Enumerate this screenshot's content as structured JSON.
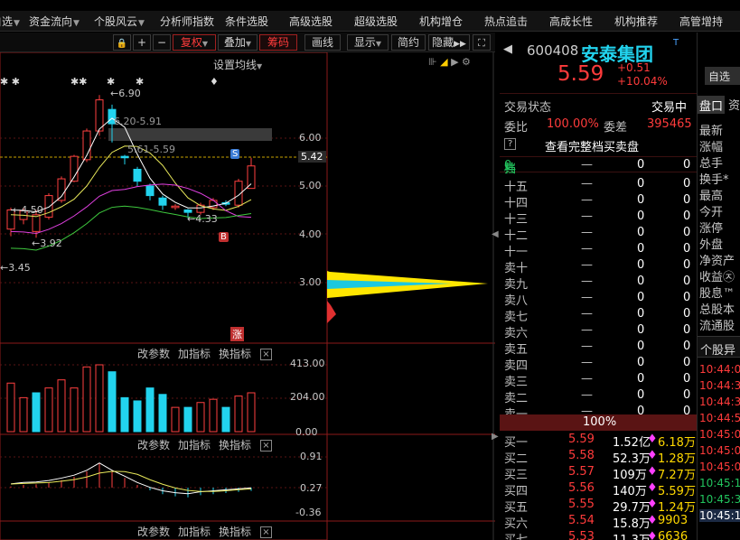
{
  "menu": {
    "items": [
      {
        "label": "自选",
        "dd": "▼"
      },
      {
        "label": "资金流向",
        "dd": "▼"
      },
      {
        "label": "个股风云",
        "dd": "▼"
      },
      {
        "label": "分析师指数",
        "dd": ""
      },
      {
        "label": "条件选股",
        "dd": ""
      },
      {
        "label": "高级选股",
        "dd": ""
      },
      {
        "label": "超级选股",
        "dd": ""
      },
      {
        "label": "机构增仓",
        "dd": ""
      },
      {
        "label": "热点追击",
        "dd": ""
      },
      {
        "label": "高成长性",
        "dd": ""
      },
      {
        "label": "机构推荐",
        "dd": ""
      },
      {
        "label": "高管增持",
        "dd": ""
      }
    ]
  },
  "toolbar": {
    "lock": "🔒",
    "plus": "+",
    "minus": "−",
    "fuquan": "复权",
    "diejia": "叠加",
    "choumai": "筹码",
    "huaxian": "画线",
    "xianshi": "显示",
    "jianyue": "简约",
    "yincang": "隐藏",
    "dd": "▼"
  },
  "chart": {
    "setting_ma": "设置均线",
    "price_axis": [
      "6.00",
      "5.00",
      "4.00",
      "3.00"
    ],
    "current_price": "5.42",
    "vol_axis": [
      "413.00",
      "204.00",
      "0.00"
    ],
    "macd_axis": [
      "0.91",
      "0.27",
      "-0.36"
    ],
    "annotations": [
      "6.90",
      "6.20-5.91",
      "5.61-5.59",
      "4.50",
      "4.50",
      "3.92",
      "4.33",
      "3.45"
    ],
    "markers": [
      "S",
      "B",
      "涨"
    ],
    "panel_tabs": [
      "改参数",
      "加指标",
      "换指标"
    ],
    "close_x": "×",
    "stars": "✱",
    "diamond": "♦",
    "arrow": "←",
    "chart_data": {
      "type": "candlestick",
      "ylim": [
        3.0,
        6.5
      ],
      "candles": [
        {
          "o": 4.1,
          "c": 4.5,
          "h": 4.55,
          "l": 3.95
        },
        {
          "o": 4.3,
          "c": 4.48,
          "h": 4.55,
          "l": 4.2
        },
        {
          "o": 4.05,
          "c": 4.4,
          "h": 4.5,
          "l": 3.92
        },
        {
          "o": 4.35,
          "c": 4.8,
          "h": 4.85,
          "l": 4.3
        },
        {
          "o": 4.7,
          "c": 5.15,
          "h": 5.2,
          "l": 4.65
        },
        {
          "o": 5.1,
          "c": 5.62,
          "h": 5.65,
          "l": 5.08
        },
        {
          "o": 5.55,
          "c": 6.15,
          "h": 6.2,
          "l": 5.5
        },
        {
          "o": 6.15,
          "c": 6.8,
          "h": 6.9,
          "l": 6.05
        },
        {
          "o": 6.6,
          "c": 6.3,
          "h": 6.7,
          "l": 5.91
        },
        {
          "o": 5.62,
          "c": 5.59,
          "h": 5.65,
          "l": 5.45
        },
        {
          "o": 5.35,
          "c": 5.1,
          "h": 5.4,
          "l": 5.0
        },
        {
          "o": 5.0,
          "c": 4.8,
          "h": 5.05,
          "l": 4.7
        },
        {
          "o": 4.75,
          "c": 4.6,
          "h": 4.8,
          "l": 4.5
        },
        {
          "o": 4.55,
          "c": 4.58,
          "h": 4.62,
          "l": 4.5
        },
        {
          "o": 4.5,
          "c": 4.45,
          "h": 4.52,
          "l": 4.33
        },
        {
          "o": 4.45,
          "c": 4.6,
          "h": 4.65,
          "l": 4.4
        },
        {
          "o": 4.55,
          "c": 4.7,
          "h": 4.75,
          "l": 4.5
        },
        {
          "o": 4.65,
          "c": 4.62,
          "h": 4.7,
          "l": 4.58
        },
        {
          "o": 4.6,
          "c": 5.1,
          "h": 5.15,
          "l": 4.55
        },
        {
          "o": 4.95,
          "c": 5.42,
          "h": 5.59,
          "l": 4.95
        }
      ],
      "volume": [
        300,
        210,
        240,
        270,
        320,
        270,
        400,
        413,
        370,
        210,
        190,
        270,
        230,
        150,
        150,
        180,
        200,
        150,
        220,
        240
      ],
      "volume_up": [
        true,
        true,
        false,
        true,
        true,
        true,
        true,
        true,
        false,
        false,
        false,
        false,
        false,
        true,
        false,
        true,
        true,
        false,
        true,
        true
      ],
      "macd": [
        0.02,
        0.05,
        0.06,
        0.09,
        0.14,
        0.2,
        0.3,
        0.45,
        0.3,
        0.18,
        0.05,
        -0.05,
        -0.12,
        -0.16,
        -0.18,
        -0.14,
        -0.12,
        -0.1,
        -0.08,
        -0.06
      ]
    }
  },
  "stock": {
    "code": "600408",
    "name": "安泰集团",
    "tag": "T",
    "price": "5.59",
    "change": "+0.51",
    "change_pct": "+10.04%",
    "status_label": "交易状态",
    "status_value": "交易中",
    "weibi_label": "委比",
    "weibi_value": "100.00%",
    "weicha_label": "委差",
    "weicha_value": "395465",
    "full_depth": "查看完整档买卖盘",
    "help": "?",
    "depth_header": "共",
    "depth_header_num": "0",
    "depth_header_tail": "档",
    "pct_bar": "100%",
    "dash": "—",
    "zero": "0",
    "sell_levels": [
      "十五",
      "十四",
      "十三",
      "十二",
      "十一",
      "卖十",
      "卖九",
      "卖八",
      "卖七",
      "卖六",
      "卖五",
      "卖四",
      "卖三",
      "卖二",
      "卖一"
    ],
    "buy_levels": [
      {
        "label": "买一",
        "price": "5.59",
        "amount": "1.52亿",
        "vol": "6.18万"
      },
      {
        "label": "买二",
        "price": "5.58",
        "amount": "52.3万",
        "vol": "1.28万"
      },
      {
        "label": "买三",
        "price": "5.57",
        "amount": "109万",
        "vol": "7.27万"
      },
      {
        "label": "买四",
        "price": "5.56",
        "amount": "140万",
        "vol": "5.59万"
      },
      {
        "label": "买五",
        "price": "5.55",
        "amount": "29.7万",
        "vol": "1.24万"
      },
      {
        "label": "买六",
        "price": "5.54",
        "amount": "15.8万",
        "vol": "9903"
      },
      {
        "label": "买七",
        "price": "5.53",
        "amount": "11.3万",
        "vol": "6636"
      }
    ]
  },
  "side": {
    "zixuan": "自选",
    "tab1": "盘口",
    "tab2": "资",
    "labels": [
      "最新",
      "涨幅",
      "总手",
      "换手*",
      "最高",
      "今开",
      "涨停",
      "外盘",
      "净资产",
      "收益㉨",
      "股息™",
      "总股本",
      "流通股"
    ],
    "gegu_label": "个股异",
    "times": [
      "10:44:0",
      "10:44:3",
      "10:44:3",
      "10:44:5",
      "10:45:0",
      "10:45:0",
      "10:45:0",
      "10:45:1",
      "10:45:3",
      "10:45:1"
    ]
  }
}
